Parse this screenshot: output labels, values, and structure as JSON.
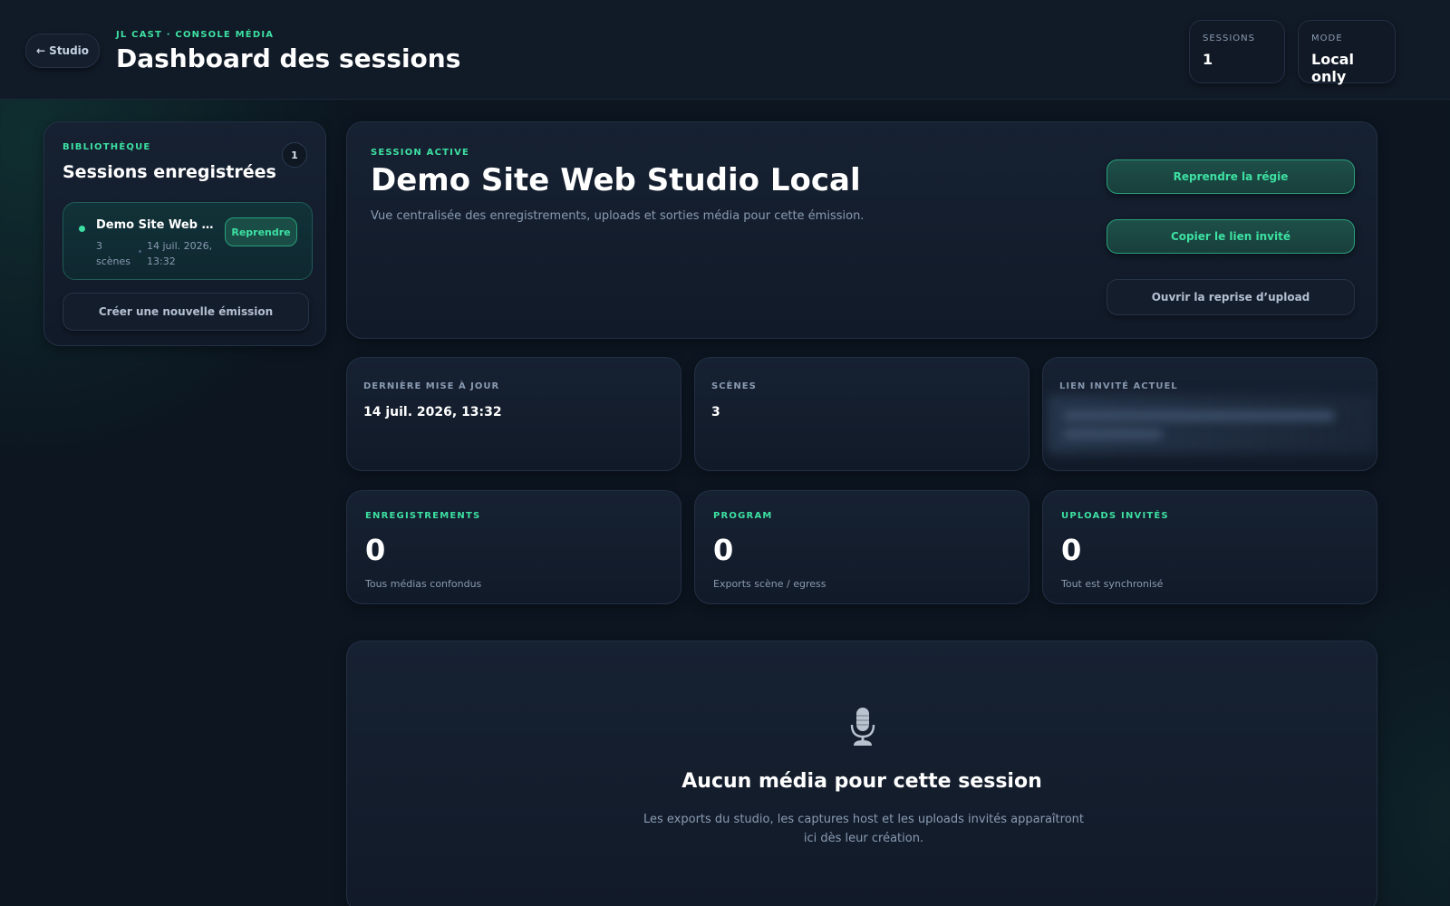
{
  "header": {
    "back_label": "← Studio",
    "eyebrow": "JL CAST · CONSOLE MÉDIA",
    "title": "Dashboard des sessions",
    "chips": [
      {
        "label": "SESSIONS",
        "value": "1"
      },
      {
        "label": "MODE",
        "value": "Local only"
      }
    ]
  },
  "library": {
    "eyebrow": "BIBLIOTHÈQUE",
    "title": "Sessions enregistrées",
    "count": "1",
    "items": [
      {
        "name": "Demo Site Web Studio Local",
        "scenes": "3 scènes",
        "date": "14 juil. 2026, 13:32",
        "action": "Reprendre"
      }
    ],
    "create_label": "Créer une nouvelle émission"
  },
  "active": {
    "eyebrow": "SESSION ACTIVE",
    "title": "Demo Site Web Studio Local",
    "description": "Vue centralisée des enregistrements, uploads et sorties média pour cette émission.",
    "actions": {
      "resume": "Reprendre la régie",
      "copy_link": "Copier le lien invité",
      "open_upload": "Ouvrir la reprise d’upload"
    }
  },
  "info": [
    {
      "label": "DERNIÈRE MISE À JOUR",
      "value": "14 juil. 2026, 13:32"
    },
    {
      "label": "SCÈNES",
      "value": "3"
    },
    {
      "label": "LIEN INVITÉ ACTUEL",
      "value": ""
    }
  ],
  "metrics": [
    {
      "label": "ENREGISTREMENTS",
      "value": "0",
      "sub": "Tous médias confondus"
    },
    {
      "label": "PROGRAM",
      "value": "0",
      "sub": "Exports scène / egress"
    },
    {
      "label": "UPLOADS INVITÉS",
      "value": "0",
      "sub": "Tout est synchronisé"
    }
  ],
  "empty": {
    "icon": "microphone-icon",
    "title": "Aucun média pour cette session",
    "text": "Les exports du studio, les captures host et les uploads invités apparaîtront ici dès leur création."
  },
  "colors": {
    "accent": "#3de0a2",
    "background": "#0c1520",
    "muted": "#8a9bb2"
  }
}
